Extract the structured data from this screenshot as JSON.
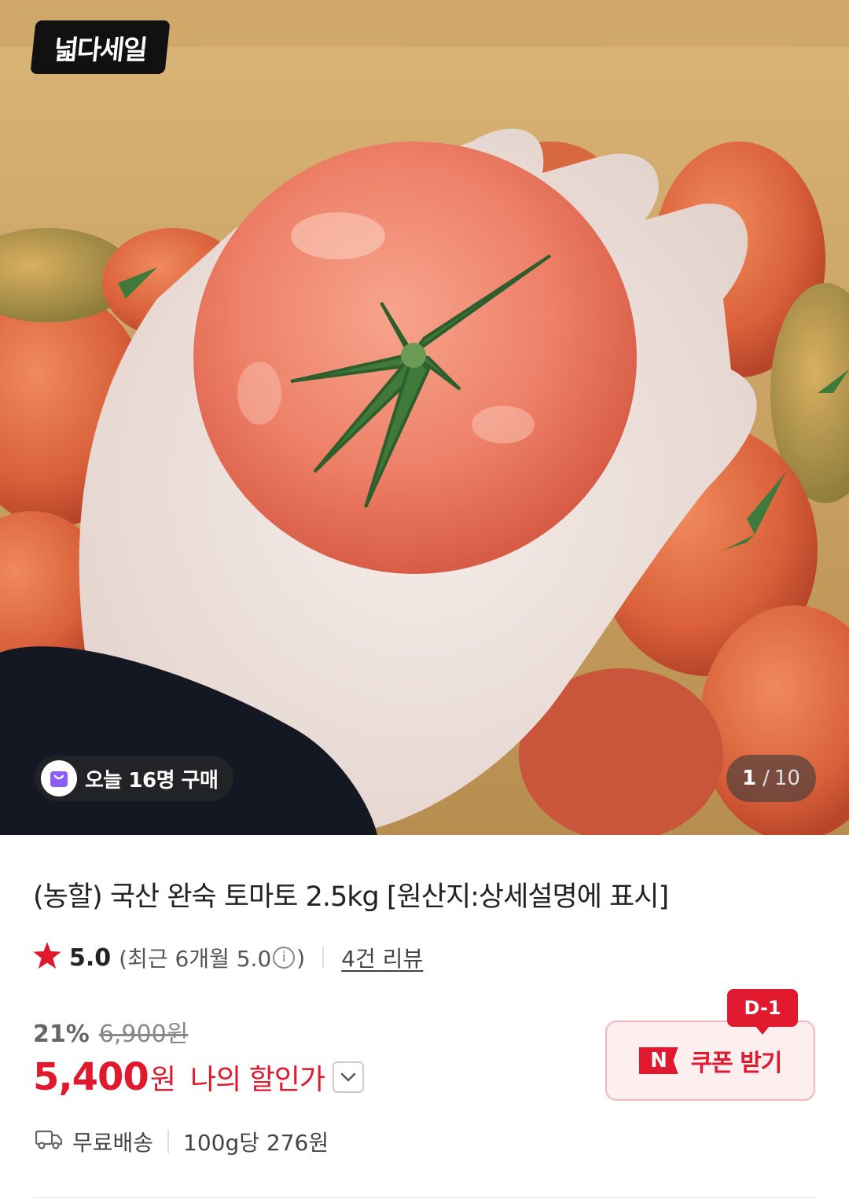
{
  "hero": {
    "brand_logo": "넓다세일",
    "buy_badge": {
      "icon": "shopping-bag-icon",
      "text": "오늘 16명 구매"
    },
    "pager": {
      "current": "1",
      "separator": "/",
      "total": "10"
    }
  },
  "product": {
    "title": "(농할) 국산 완숙 토마토 2.5kg [원산지:상세설명에 표시]",
    "rating": {
      "score": "5.0",
      "recent_prefix": "(최근 6개월 5.0",
      "info_icon": "ⓘ",
      "recent_suffix": ")",
      "reviews_link": "4건 리뷰"
    },
    "price": {
      "discount_pct": "21%",
      "original": "6,900원",
      "sale": "5,400",
      "currency": "원",
      "my_discount_label": "나의 할인가"
    },
    "shipping": {
      "label": "무료배송",
      "unit_price": "100g당 276원"
    }
  },
  "coupon": {
    "dday": "D-1",
    "logo": "N",
    "label": "쿠폰 받기"
  },
  "colors": {
    "accent": "#e1192f",
    "coupon_bg": "#fdeff0",
    "coupon_border": "#f4b7bd"
  }
}
